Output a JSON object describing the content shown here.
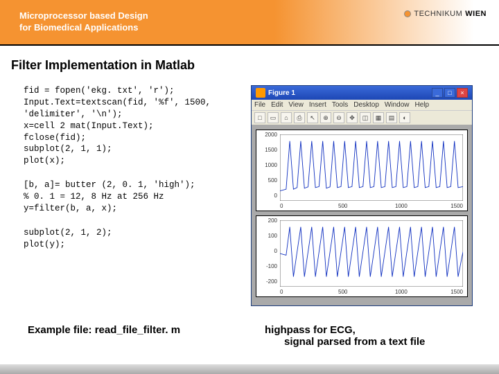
{
  "header": {
    "title_line1": "Microprocessor based Design",
    "title_line2": "for Biomedical Applications",
    "logo_text1": "TECHNIKUM",
    "logo_text2": "WIEN"
  },
  "slide": {
    "title": "Filter Implementation in Matlab"
  },
  "code": {
    "block1": "fid = fopen('ekg. txt', 'r');\nInput.Text=textscan(fid, '%f', 1500,\n'delimiter', '\\n');\nx=cell 2 mat(Input.Text);\nfclose(fid);\nsubplot(2, 1, 1);\nplot(x);",
    "block2": "[b, a]= butter (2, 0. 1, 'high');\n% 0. 1 = 12, 8 Hz at 256 Hz\ny=filter(b, a, x);",
    "block3": "subplot(2, 1, 2);\nplot(y);"
  },
  "figwin": {
    "title": "Figure 1",
    "menu": [
      "File",
      "Edit",
      "View",
      "Insert",
      "Tools",
      "Desktop",
      "Window",
      "Help"
    ],
    "toolbar_icons": [
      "□",
      "▭",
      "⌂",
      "⎙",
      "↖",
      "⊕",
      "⊖",
      "✥",
      "◫",
      "▦",
      "▤",
      "◐"
    ]
  },
  "chart_data": [
    {
      "type": "line",
      "title": "",
      "xlabel": "",
      "ylabel": "",
      "xlim": [
        0,
        1500
      ],
      "ylim": [
        0,
        2000
      ],
      "yticks": [
        0,
        500,
        1000,
        1500,
        2000
      ],
      "xticks": [
        0,
        500,
        1000,
        1500
      ],
      "x": [
        0,
        50,
        80,
        110,
        140,
        170,
        200,
        230,
        260,
        290,
        320,
        350,
        380,
        410,
        440,
        470,
        500,
        530,
        560,
        590,
        620,
        650,
        680,
        710,
        740,
        770,
        800,
        830,
        860,
        890,
        920,
        950,
        980,
        1010,
        1040,
        1070,
        1100,
        1130,
        1160,
        1190,
        1220,
        1250,
        1280,
        1310,
        1340,
        1370,
        1400,
        1430,
        1460,
        1500
      ],
      "y": [
        300,
        350,
        1800,
        350,
        400,
        1800,
        380,
        420,
        1800,
        400,
        430,
        1800,
        380,
        420,
        1800,
        400,
        430,
        1800,
        400,
        430,
        1800,
        400,
        430,
        1800,
        400,
        430,
        1800,
        400,
        430,
        1800,
        400,
        430,
        1800,
        400,
        430,
        1800,
        400,
        430,
        1800,
        400,
        430,
        1800,
        400,
        430,
        1800,
        400,
        430,
        1800,
        400,
        430
      ]
    },
    {
      "type": "line",
      "title": "",
      "xlabel": "",
      "ylabel": "",
      "xlim": [
        0,
        1500
      ],
      "ylim": [
        -200,
        200
      ],
      "yticks": [
        -200,
        -100,
        0,
        100,
        200
      ],
      "xticks": [
        0,
        500,
        1000,
        1500
      ],
      "x": [
        0,
        50,
        80,
        110,
        140,
        170,
        200,
        230,
        260,
        290,
        320,
        350,
        380,
        410,
        440,
        470,
        500,
        530,
        560,
        590,
        620,
        650,
        680,
        710,
        740,
        770,
        800,
        830,
        860,
        890,
        920,
        950,
        980,
        1010,
        1040,
        1070,
        1100,
        1130,
        1160,
        1190,
        1220,
        1250,
        1280,
        1310,
        1340,
        1370,
        1400,
        1430,
        1460,
        1500
      ],
      "y": [
        0,
        -10,
        160,
        -140,
        10,
        160,
        -140,
        10,
        160,
        -140,
        10,
        160,
        -140,
        10,
        160,
        -140,
        10,
        160,
        -140,
        10,
        160,
        -140,
        10,
        160,
        -140,
        10,
        160,
        -140,
        10,
        160,
        -140,
        10,
        160,
        -140,
        10,
        160,
        -140,
        10,
        160,
        -140,
        10,
        160,
        -140,
        10,
        160,
        -140,
        10,
        160,
        -140,
        10
      ]
    }
  ],
  "captions": {
    "left": "Example file: read_file_filter. m",
    "right_line1": "highpass for ECG,",
    "right_line2": "signal parsed from a text file"
  }
}
